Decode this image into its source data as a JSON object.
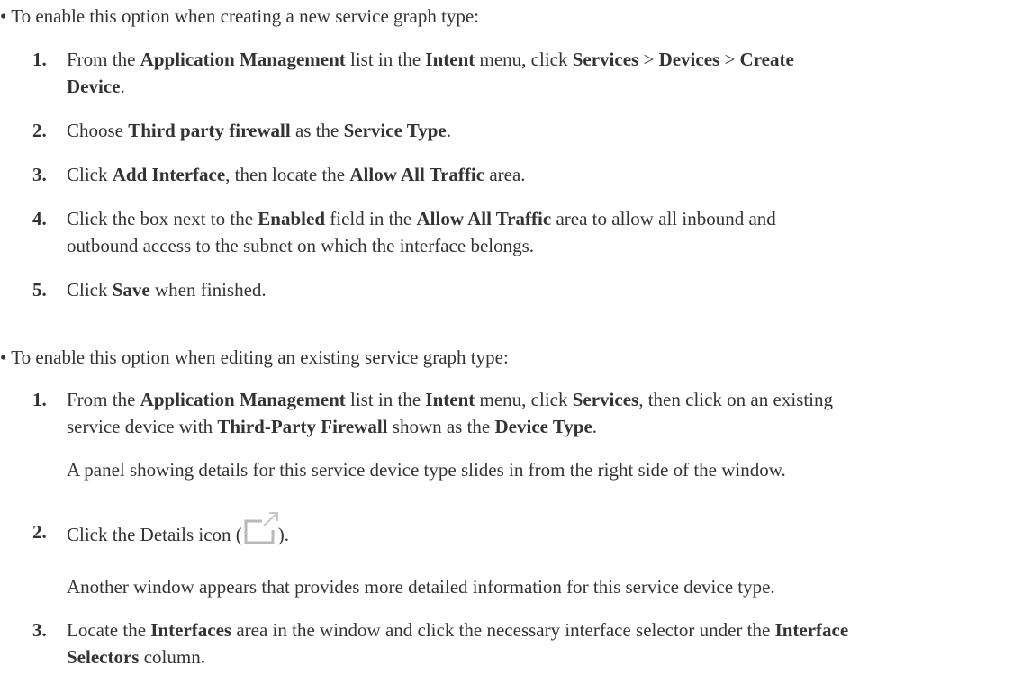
{
  "section1": {
    "bullet": "• To enable this option when creating a new service graph type:",
    "steps": [
      {
        "num": "1.",
        "t1": "From the ",
        "b1": "Application Management",
        "t2": " list in the ",
        "b2": "Intent",
        "t3": " menu, click ",
        "b3": "Services",
        "t4": " > ",
        "b4": "Devices",
        "t5": " > ",
        "b5": "Create",
        "b6": "Device",
        "t6": "."
      },
      {
        "num": "2.",
        "t1": "Choose ",
        "b1": "Third party firewall",
        "t2": " as the ",
        "b2": "Service Type",
        "t3": "."
      },
      {
        "num": "3.",
        "t1": "Click ",
        "b1": "Add Interface",
        "t2": ", then locate the ",
        "b2": "Allow All Traffic",
        "t3": " area."
      },
      {
        "num": "4.",
        "t1": "Click the box next to the ",
        "b1": "Enabled",
        "t2": " field in the ",
        "b2": "Allow All Traffic",
        "t3": " area to allow all inbound and",
        "line2": "outbound access to the subnet on which the interface belongs."
      },
      {
        "num": "5.",
        "t1": "Click ",
        "b1": "Save",
        "t2": " when finished."
      }
    ]
  },
  "section2": {
    "bullet": "• To enable this option when editing an existing service graph type:",
    "steps": [
      {
        "num": "1.",
        "t1": "From the ",
        "b1": "Application Management",
        "t2": " list in the ",
        "b2": "Intent",
        "t3": " menu, click ",
        "b3": "Services",
        "t4": ", then click on an existing",
        "line2a": "service device with ",
        "b4": "Third-Party Firewall",
        "line2b": " shown as the ",
        "b5": "Device Type",
        "line2c": ".",
        "note": "A panel showing details for this service device type slides in from the right side of the window."
      },
      {
        "num": "2.",
        "t1": "Click the Details icon (",
        "icon": "details-icon",
        "t2": ").",
        "note": "Another window appears that provides more detailed information for this service device type."
      },
      {
        "num": "3.",
        "t1": "Locate the ",
        "b1": "Interfaces",
        "t2": " area in the window and click the necessary interface selector under the ",
        "b2": "Interface",
        "b3": "Selectors",
        "t3": " column."
      }
    ]
  }
}
